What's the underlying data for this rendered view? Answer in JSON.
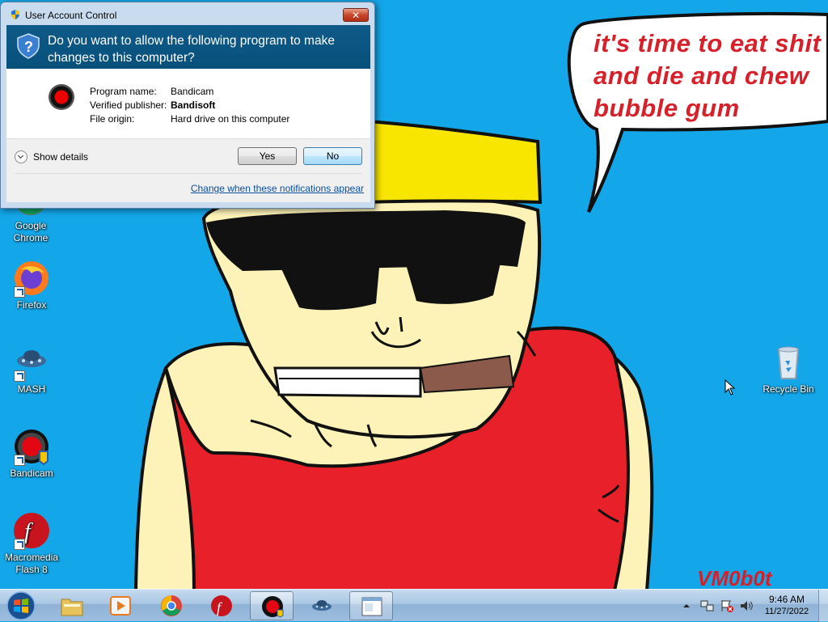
{
  "wallpaper": {
    "speech_text": "it's time to eat shit\nand die and chew\nbubble gum",
    "signature": "VM0b0t"
  },
  "desktop_icons": [
    {
      "label": "Google Chrome",
      "icon": "chrome-icon"
    },
    {
      "label": "Firefox",
      "icon": "firefox-icon"
    },
    {
      "label": "MASH",
      "icon": "mash-icon"
    },
    {
      "label": "Bandicam",
      "icon": "bandicam-icon"
    },
    {
      "label": "Macromedia Flash 8",
      "icon": "flash-icon"
    },
    {
      "label": "Recycle Bin",
      "icon": "recycle-bin-icon"
    }
  ],
  "uac": {
    "title": "User Account Control",
    "close": "✕",
    "question": "Do you want to allow the following program to make changes to this computer?",
    "program_name_label": "Program name:",
    "program_name": "Bandicam",
    "publisher_label": "Verified publisher:",
    "publisher": "Bandisoft",
    "origin_label": "File origin:",
    "origin": "Hard drive on this computer",
    "show_details": "Show details",
    "yes": "Yes",
    "no": "No",
    "notification_link": "Change when these notifications appear"
  },
  "taskbar": {
    "items": [
      "start-orb",
      "explorer",
      "media-player",
      "chrome",
      "flash",
      "bandicam",
      "mash",
      "uac-window"
    ],
    "clock_time": "9:46 AM",
    "clock_date": "11/27/2022"
  },
  "colors": {
    "desktop": "#13a6e8",
    "uac_banner": "#0f5a88",
    "speech_text": "#d8202a"
  }
}
